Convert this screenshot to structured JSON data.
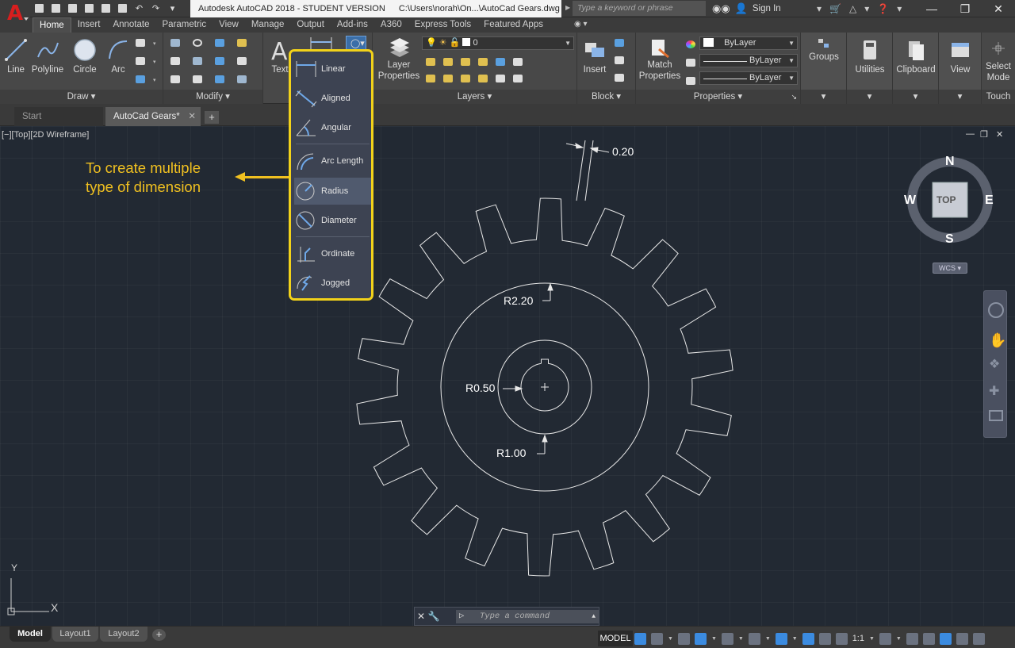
{
  "title_bar": {
    "app_title": "Autodesk AutoCAD 2018 - STUDENT VERSION",
    "file_path": "C:\\Users\\norah\\On...\\AutoCad Gears.dwg",
    "search_placeholder": "Type a keyword or phrase",
    "sign_in_label": "Sign In"
  },
  "ribbon_tabs": [
    "Home",
    "Insert",
    "Annotate",
    "Parametric",
    "View",
    "Manage",
    "Output",
    "Add-ins",
    "A360",
    "Express Tools",
    "Featured Apps"
  ],
  "active_tab": "Home",
  "ribbon": {
    "draw": {
      "title": "Draw",
      "line": "Line",
      "polyline": "Polyline",
      "circle": "Circle",
      "arc": "Arc"
    },
    "modify": {
      "title": "Modify"
    },
    "annotation": {
      "text": "Text"
    },
    "layers": {
      "title": "Layers",
      "layer_properties": "Layer\nProperties",
      "current_layer": "0"
    },
    "block": {
      "title": "Block",
      "insert": "Insert"
    },
    "properties": {
      "title": "Properties",
      "match": "Match\nProperties",
      "color": "ByLayer",
      "linetype": "ByLayer",
      "lineweight": "ByLayer"
    },
    "groups": {
      "label": "Groups"
    },
    "utilities": {
      "label": "Utilities"
    },
    "clipboard": {
      "label": "Clipboard"
    },
    "view": {
      "label": "View"
    },
    "touch": {
      "select_mode": "Select\nMode",
      "title": "Touch"
    }
  },
  "file_tabs": {
    "start": "Start",
    "active": "AutoCad Gears*"
  },
  "viewport_label": "[−][Top][2D Wireframe]",
  "dimension_menu": {
    "items": [
      "Linear",
      "Aligned",
      "Angular",
      "Arc Length",
      "Radius",
      "Diameter",
      "Ordinate",
      "Jogged"
    ],
    "selected": "Radius"
  },
  "annotation_callout": "To create multiple\ntype of dimension",
  "drawing_dimensions": {
    "width": "0.20",
    "r_outer": "R2.20",
    "r_mid": "R1.00",
    "r_inner": "R0.50"
  },
  "viewcube": {
    "north": "N",
    "south": "S",
    "east": "E",
    "west": "W",
    "face": "TOP",
    "wcs": "WCS"
  },
  "ucs": {
    "x": "X",
    "y": "Y"
  },
  "command_line": {
    "placeholder": "Type a command"
  },
  "status_bar": {
    "layouts": [
      "Model",
      "Layout1",
      "Layout2"
    ],
    "model_label": "MODEL",
    "scale": "1:1"
  },
  "colors": {
    "accent_yellow": "#f2d21a",
    "canvas": "#222933",
    "ribbon": "#484848",
    "autocad_red": "#d81e1e"
  }
}
